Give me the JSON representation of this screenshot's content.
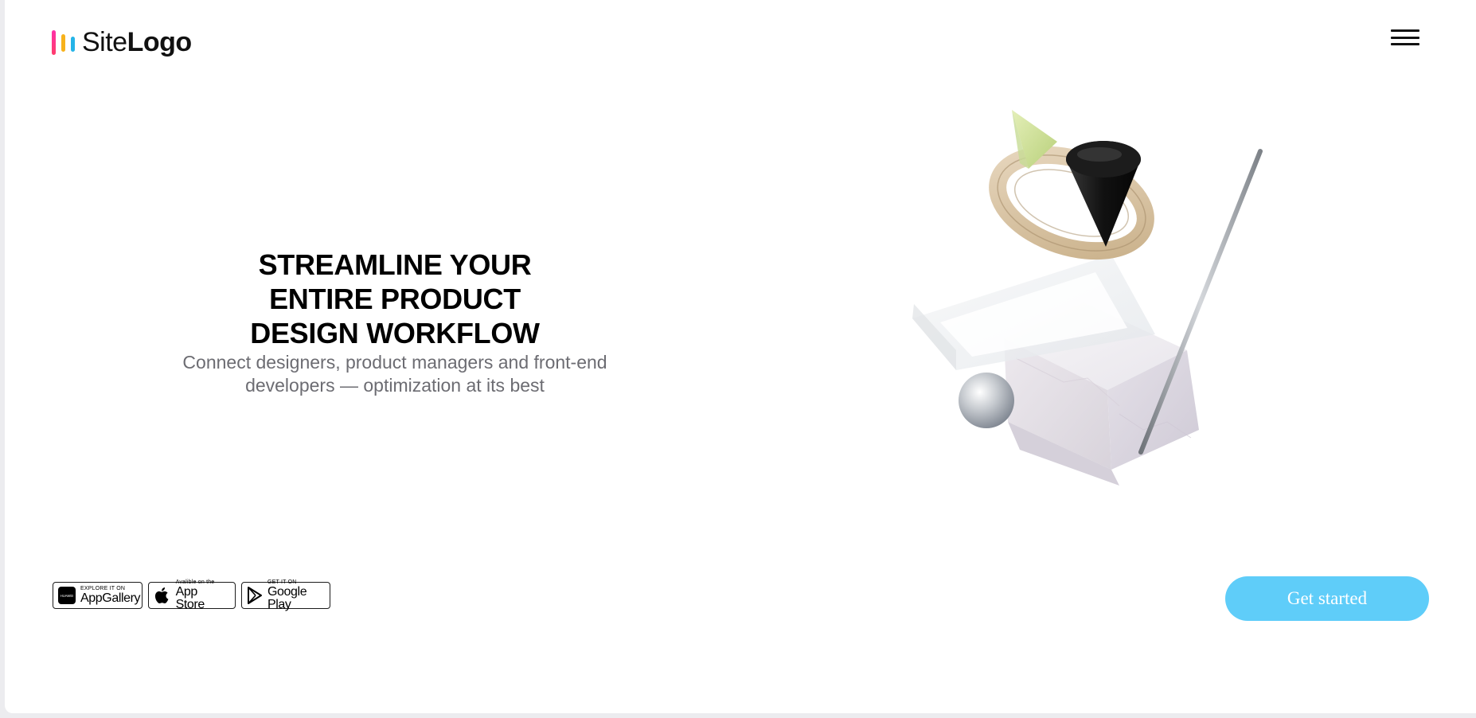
{
  "logo": {
    "text_thin": "Site",
    "text_bold": "Logo"
  },
  "menu": {
    "icon": "hamburger-menu-icon"
  },
  "hero": {
    "title_lines": [
      "STREAMLINE YOUR",
      "ENTIRE PRODUCT",
      "DESIGN WORKFLOW"
    ],
    "subtitle_lines": [
      "Connect designers, product managers and front-end",
      "developers — optimization at its best"
    ]
  },
  "badges": {
    "appgallery": {
      "small": "EXPLORE IT ON",
      "big": "AppGallery",
      "icon_label": "HUAWEI",
      "icon": "huawei-icon"
    },
    "appstore": {
      "small": "Avalible on the",
      "big": "App Store",
      "icon": "apple-icon"
    },
    "googleplay": {
      "small": "GET IT ON",
      "big": "Google Play",
      "icon": "google-play-icon"
    }
  },
  "cta": {
    "label": "Get started"
  },
  "colors": {
    "cta_background": "#5fcdf9",
    "logo_bar_pink": "#ff2fa8",
    "logo_bar_yellow": "#f7b21c",
    "logo_bar_blue": "#25b4e8"
  }
}
